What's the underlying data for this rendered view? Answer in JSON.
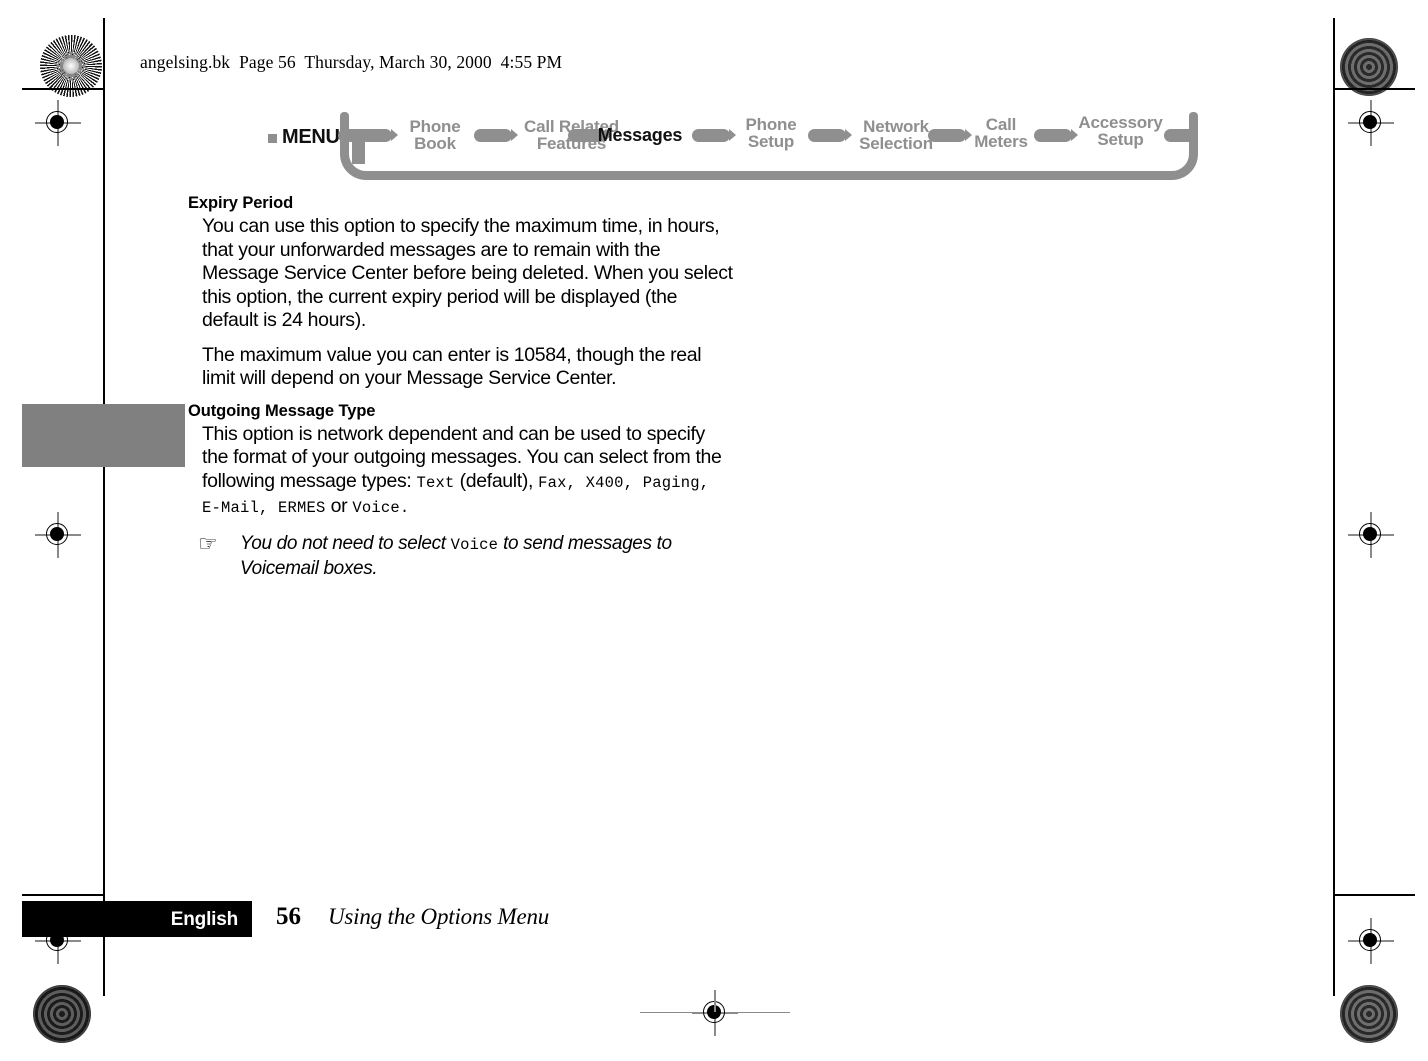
{
  "file_header": "angelsing.bk  Page 56  Thursday, March 30, 2000  4:55 PM",
  "nav": {
    "menu_label": "MENU",
    "active_color": "#111111",
    "inactive_color": "#8f8f8f",
    "items": [
      {
        "label": "Phone\nBook",
        "active": false
      },
      {
        "label": "Call Related\nFeatures",
        "active": false
      },
      {
        "label": "Messages",
        "active": true
      },
      {
        "label": "Phone\nSetup",
        "active": false
      },
      {
        "label": "Network\nSelection",
        "active": false
      },
      {
        "label": "Call\nMeters",
        "active": false
      },
      {
        "label": "Accessory\nSetup",
        "active": false
      }
    ]
  },
  "content": {
    "section1": {
      "heading": "Expiry Period",
      "para1": "You can use this option to specify the maximum time, in hours, that your unforwarded messages are to remain with the Message Service Center before being deleted. When you select this option, the current expiry period will be displayed (the default is 24 hours).",
      "para2": "The maximum value you can enter is 10584, though the real limit will depend on your Message Service Center."
    },
    "section2": {
      "heading": "Outgoing Message Type",
      "para_lead": "This option is network dependent and can be used to specify the format of your outgoing messages. You can select from the following message types: ",
      "type_text": "Text",
      "after_text": " (default), ",
      "type_fax": "Fax",
      "sep1": ", ",
      "type_x400": "X400",
      "sep2": ", ",
      "type_paging": "Paging",
      "sep3": ", ",
      "type_email": "E-Mail",
      "sep4": ", ",
      "type_ermes": "ERMES",
      "conjunction": " or ",
      "type_voice": "Voice",
      "period": ".",
      "note_icon": "☞",
      "note_part1": "You do not need to select ",
      "note_mono": "Voice",
      "note_part2": " to send messages to Voicemail boxes."
    }
  },
  "footer": {
    "language": "English",
    "page_number": "56",
    "section_title": "Using the Options Menu"
  }
}
